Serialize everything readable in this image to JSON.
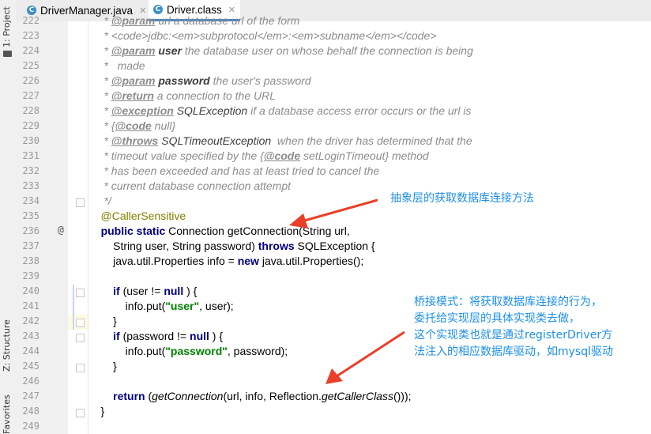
{
  "tabs": [
    {
      "label": "DriverManager.java",
      "icon": "java-class-icon",
      "active": false
    },
    {
      "label": "Driver.class",
      "icon": "java-class-icon",
      "active": true
    }
  ],
  "sidebar": {
    "project": "1: Project",
    "structure": "Z: Structure",
    "favorites": "Favorites"
  },
  "lines": [
    {
      "n": "222",
      "tokens": [
        [
          "cm",
          "     * "
        ],
        [
          "tag",
          "@param"
        ],
        [
          "cm",
          " url a database url of the form"
        ]
      ]
    },
    {
      "n": "223",
      "tokens": [
        [
          "cm",
          "     * <code>jdbc:<em>subprotocol</em>:<em>subname</em></code>"
        ]
      ]
    },
    {
      "n": "224",
      "tokens": [
        [
          "cm",
          "     * "
        ],
        [
          "tag",
          "@param"
        ],
        [
          "cm",
          " "
        ],
        [
          "pname",
          "user"
        ],
        [
          "cm",
          " the database user on whose behalf the connection is being"
        ]
      ]
    },
    {
      "n": "225",
      "tokens": [
        [
          "cm",
          "     *   made"
        ]
      ]
    },
    {
      "n": "226",
      "tokens": [
        [
          "cm",
          "     * "
        ],
        [
          "tag",
          "@param"
        ],
        [
          "cm",
          " "
        ],
        [
          "pname",
          "password"
        ],
        [
          "cm",
          " the user's password"
        ]
      ]
    },
    {
      "n": "227",
      "tokens": [
        [
          "cm",
          "     * "
        ],
        [
          "tag",
          "@return"
        ],
        [
          "cm",
          " a connection to the URL"
        ]
      ]
    },
    {
      "n": "228",
      "tokens": [
        [
          "cm",
          "     * "
        ],
        [
          "tag",
          "@exception"
        ],
        [
          "cm",
          " "
        ],
        [
          "ref",
          "SQLException"
        ],
        [
          "cm",
          " if a database access error occurs or the url is"
        ]
      ]
    },
    {
      "n": "229",
      "tokens": [
        [
          "cm",
          "     * {"
        ],
        [
          "tag",
          "@code"
        ],
        [
          "cm",
          " null}"
        ]
      ]
    },
    {
      "n": "230",
      "tokens": [
        [
          "cm",
          "     * "
        ],
        [
          "tag",
          "@throws"
        ],
        [
          "cm",
          " "
        ],
        [
          "ref",
          "SQLTimeoutException"
        ],
        [
          "cm",
          "  when the driver has determined that the"
        ]
      ]
    },
    {
      "n": "231",
      "tokens": [
        [
          "cm",
          "     * timeout value specified by the {"
        ],
        [
          "tag",
          "@code"
        ],
        [
          "cm",
          " setLoginTimeout} method"
        ]
      ]
    },
    {
      "n": "232",
      "tokens": [
        [
          "cm",
          "     * has been exceeded and has at least tried to cancel the"
        ]
      ]
    },
    {
      "n": "233",
      "tokens": [
        [
          "cm",
          "     * current database connection attempt"
        ]
      ]
    },
    {
      "n": "234",
      "tokens": [
        [
          "cm",
          "     */"
        ]
      ]
    },
    {
      "n": "235",
      "tokens": [
        [
          "ann",
          "    @CallerSensitive"
        ]
      ]
    },
    {
      "n": "236",
      "tokens": [
        [
          "",
          "    "
        ],
        [
          "kw",
          "public static"
        ],
        [
          "",
          " Connection getConnection(String url,"
        ]
      ]
    },
    {
      "n": "237",
      "tokens": [
        [
          "",
          "        String user, String password) "
        ],
        [
          "kw",
          "throws"
        ],
        [
          "",
          " SQLException {"
        ]
      ]
    },
    {
      "n": "238",
      "tokens": [
        [
          "",
          "        java.util.Properties info = "
        ],
        [
          "kw",
          "new"
        ],
        [
          "",
          " java.util.Properties();"
        ]
      ]
    },
    {
      "n": "239",
      "tokens": [
        [
          "",
          ""
        ]
      ]
    },
    {
      "n": "240",
      "tokens": [
        [
          "",
          "        "
        ],
        [
          "kw",
          "if"
        ],
        [
          "",
          " (user != "
        ],
        [
          "kw",
          "null"
        ],
        [
          "",
          " ) {"
        ]
      ]
    },
    {
      "n": "241",
      "tokens": [
        [
          "",
          "            info.put("
        ],
        [
          "str",
          "\"user\""
        ],
        [
          "",
          ", user);"
        ]
      ]
    },
    {
      "n": "242",
      "tokens": [
        [
          "",
          "        }"
        ]
      ]
    },
    {
      "n": "243",
      "tokens": [
        [
          "",
          "        "
        ],
        [
          "kw",
          "if"
        ],
        [
          "",
          " (password != "
        ],
        [
          "kw",
          "null"
        ],
        [
          "",
          " ) {"
        ]
      ]
    },
    {
      "n": "244",
      "tokens": [
        [
          "",
          "            info.put("
        ],
        [
          "str",
          "\"password\""
        ],
        [
          "",
          ", password);"
        ]
      ]
    },
    {
      "n": "245",
      "tokens": [
        [
          "",
          "        }"
        ]
      ]
    },
    {
      "n": "246",
      "tokens": [
        [
          "",
          ""
        ]
      ]
    },
    {
      "n": "247",
      "tokens": [
        [
          "",
          "        "
        ],
        [
          "kw",
          "return"
        ],
        [
          "",
          " ("
        ],
        [
          "it",
          "getConnection"
        ],
        [
          "",
          "(url, info, Reflection."
        ],
        [
          "it",
          "getCallerClass"
        ],
        [
          "",
          "()));"
        ]
      ]
    },
    {
      "n": "248",
      "tokens": [
        [
          "",
          "    }"
        ]
      ]
    },
    {
      "n": "249",
      "tokens": [
        [
          "",
          ""
        ]
      ]
    }
  ],
  "annotations": {
    "a1": "抽象层的获取数据库连接方法",
    "a2": [
      "桥接模式：将获取数据库连接的行为，",
      "委托给实现层的具体实现类去做，",
      "这个实现类也就是通过registerDriver方",
      "法注入的相应数据库驱动，如mysql驱动"
    ]
  },
  "gutter_marker": "@",
  "colors": {
    "annotation": "#1e8fe6",
    "arrow": "#e8402a",
    "keyword": "#000080",
    "string": "#008000",
    "comment": "#8c8c8c",
    "annotation_code": "#808000",
    "highlight": "#fffae3"
  }
}
